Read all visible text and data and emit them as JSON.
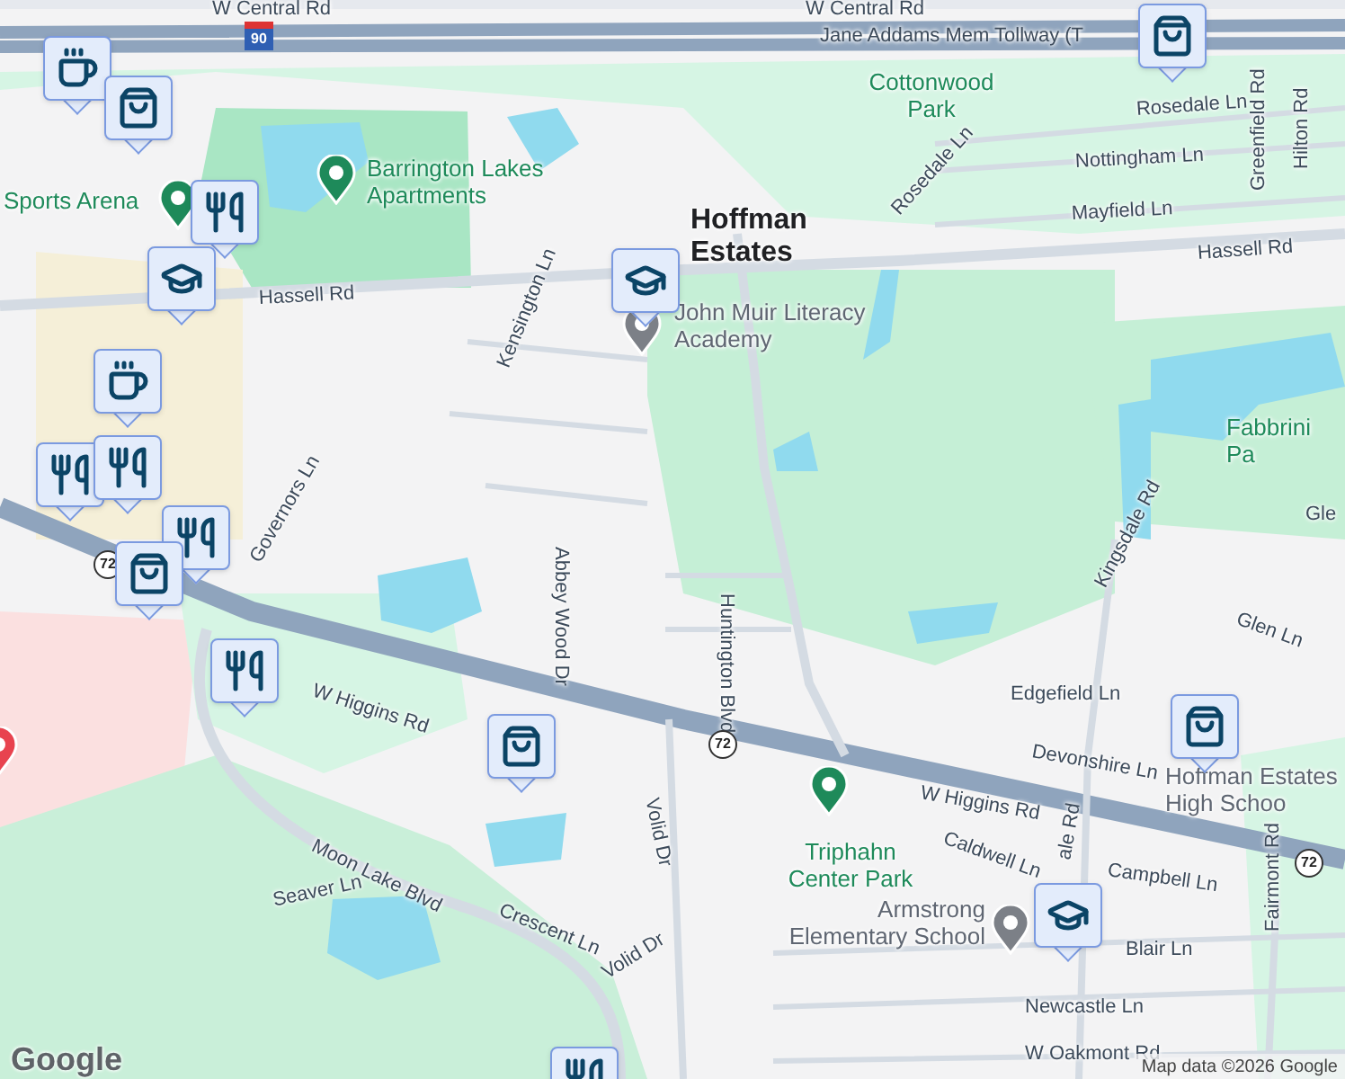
{
  "map": {
    "labels": [
      {
        "text": "W Central Rd",
        "kind": "road"
      },
      {
        "text": "W Central Rd",
        "kind": "road"
      },
      {
        "text": "Jane Addams Mem Tollway (T",
        "kind": "road"
      },
      {
        "text": "Cottonwood Park",
        "kind": "park"
      },
      {
        "text": "Sports Arena",
        "kind": "park"
      },
      {
        "text": "Barrington Lakes Apartments",
        "kind": "park"
      },
      {
        "text": "Hoffman Estates",
        "kind": "city"
      },
      {
        "text": "John Muir Literacy Academy",
        "kind": "school"
      },
      {
        "text": "Hassell Rd",
        "kind": "road"
      },
      {
        "text": "Hassell Rd",
        "kind": "road"
      },
      {
        "text": "Rosedale Ln",
        "kind": "road"
      },
      {
        "text": "Rosedale Ln",
        "kind": "road"
      },
      {
        "text": "Nottingham Ln",
        "kind": "road"
      },
      {
        "text": "Mayfield Ln",
        "kind": "road"
      },
      {
        "text": "Greenfield Rd",
        "kind": "road"
      },
      {
        "text": "Hilton Rd",
        "kind": "road"
      },
      {
        "text": "Kensington Ln",
        "kind": "road"
      },
      {
        "text": "Abbey Wood Dr",
        "kind": "road"
      },
      {
        "text": "Governors Ln",
        "kind": "road"
      },
      {
        "text": "Huntington Blvd",
        "kind": "road"
      },
      {
        "text": "Fabbrini Pa",
        "kind": "park"
      },
      {
        "text": "Gle",
        "kind": "road"
      },
      {
        "text": "Kingsdale Rd",
        "kind": "road"
      },
      {
        "text": "Glen Ln",
        "kind": "road"
      },
      {
        "text": "Edgefield Ln",
        "kind": "road"
      },
      {
        "text": "Devonshire Ln",
        "kind": "road"
      },
      {
        "text": "Hoffman Estates High Schoo",
        "kind": "school"
      },
      {
        "text": "W Higgins Rd",
        "kind": "road"
      },
      {
        "text": "W Higgins Rd",
        "kind": "road"
      },
      {
        "text": "Triphahn Center Park",
        "kind": "park"
      },
      {
        "text": "Caldwell Ln",
        "kind": "road"
      },
      {
        "text": "Campbell Ln",
        "kind": "road"
      },
      {
        "text": "ale Rd",
        "kind": "road"
      },
      {
        "text": "Fairmont Rd",
        "kind": "road"
      },
      {
        "text": "Armstrong Elementary School",
        "kind": "school"
      },
      {
        "text": "Blair Ln",
        "kind": "road"
      },
      {
        "text": "Newcastle Ln",
        "kind": "road"
      },
      {
        "text": "W Oakmont Rd",
        "kind": "road"
      },
      {
        "text": "Volid Dr",
        "kind": "road"
      },
      {
        "text": "Moon Lake Blvd",
        "kind": "road"
      },
      {
        "text": "Seaver Ln",
        "kind": "road"
      },
      {
        "text": "Crescent Ln",
        "kind": "road"
      },
      {
        "text": "Volid Dr",
        "kind": "road"
      }
    ],
    "shields": [
      {
        "text": "90",
        "kind": "interstate"
      },
      {
        "text": "72",
        "kind": "state"
      },
      {
        "text": "72",
        "kind": "state"
      },
      {
        "text": "72",
        "kind": "state"
      }
    ],
    "pins": [
      {
        "kind": "park"
      },
      {
        "kind": "park"
      },
      {
        "kind": "park"
      },
      {
        "kind": "hospital"
      },
      {
        "kind": "school"
      },
      {
        "kind": "school"
      }
    ],
    "markers": [
      {
        "kind": "cafe"
      },
      {
        "kind": "shop"
      },
      {
        "kind": "food"
      },
      {
        "kind": "school"
      },
      {
        "kind": "school"
      },
      {
        "kind": "cafe"
      },
      {
        "kind": "food"
      },
      {
        "kind": "food"
      },
      {
        "kind": "food"
      },
      {
        "kind": "shop"
      },
      {
        "kind": "food"
      },
      {
        "kind": "shop"
      },
      {
        "kind": "shop"
      },
      {
        "kind": "shop"
      },
      {
        "kind": "school"
      },
      {
        "kind": "food"
      }
    ],
    "logo": "Google",
    "attribution": "Map data ©2026 Google"
  }
}
